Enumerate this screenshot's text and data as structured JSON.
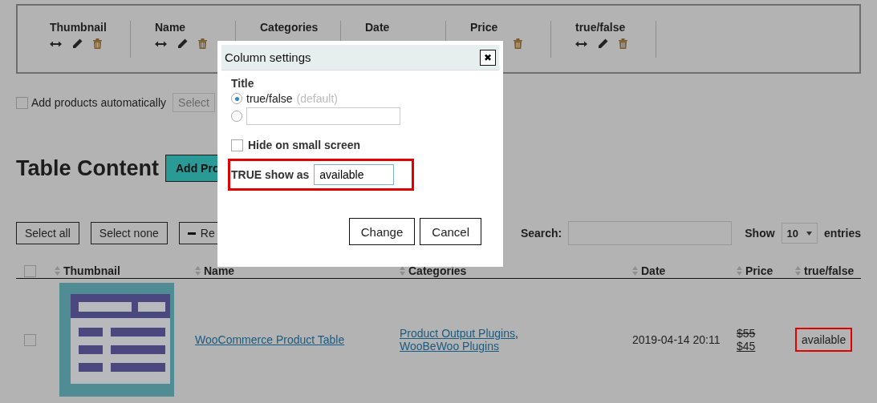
{
  "column_panel": {
    "columns": [
      {
        "label": "Thumbnail",
        "icons": [
          {
            "kind": "resize"
          },
          {
            "kind": "edit"
          },
          {
            "kind": "delete"
          }
        ]
      },
      {
        "label": "Name",
        "icons": [
          {
            "kind": "resize"
          },
          {
            "kind": "edit"
          },
          {
            "kind": "delete"
          }
        ]
      },
      {
        "label": "Categories"
      },
      {
        "label": "Date"
      },
      {
        "label": "Price",
        "icons": [
          {
            "kind": "delete"
          }
        ]
      },
      {
        "label": "true/false",
        "icons": [
          {
            "kind": "resize"
          },
          {
            "kind": "edit"
          },
          {
            "kind": "delete"
          }
        ]
      }
    ]
  },
  "auto_add": {
    "label": "Add products automatically",
    "checked": false,
    "select_placeholder": "Select"
  },
  "heading": "Table Content",
  "add_button": "Add Pro",
  "bulk_buttons": [
    {
      "label": "Select all",
      "kind": "plain"
    },
    {
      "label": "Select none",
      "kind": "plain"
    },
    {
      "label": "Re",
      "kind": "minus"
    }
  ],
  "search": {
    "label": "Search:"
  },
  "length": {
    "label_before": "Show",
    "value": "10",
    "label_after": "entries"
  },
  "table": {
    "select_all": {
      "checked": false
    },
    "columns": [
      {
        "label": "Thumbnail"
      },
      {
        "label": "Name"
      },
      {
        "label": "Categories"
      },
      {
        "label": "Date"
      },
      {
        "label": "Price"
      },
      {
        "label": "true/false"
      }
    ],
    "rows": [
      {
        "checked": false,
        "name": "WooCommerce Product Table",
        "categories": [
          {
            "label": "Product Output Plugins",
            "sep": ","
          },
          {
            "label": "WooBeWoo Plugins"
          }
        ],
        "date": "2019-04-14 20:11",
        "old_price": "$55",
        "price": "$45",
        "status": "available",
        "highlighted": true
      }
    ]
  },
  "dialog": {
    "title": "Column settings",
    "close": "✖",
    "title_label": "Title",
    "options": [
      {
        "kind": "text",
        "label": "true/false",
        "hint": "(default)",
        "selected": true
      },
      {
        "kind": "input",
        "selected": false
      }
    ],
    "hide_small": {
      "label": "Hide on small screen",
      "checked": false
    },
    "true_label": "TRUE show as",
    "true_value": "available",
    "highlighted": true,
    "buttons": [
      "Change",
      "Cancel"
    ]
  }
}
